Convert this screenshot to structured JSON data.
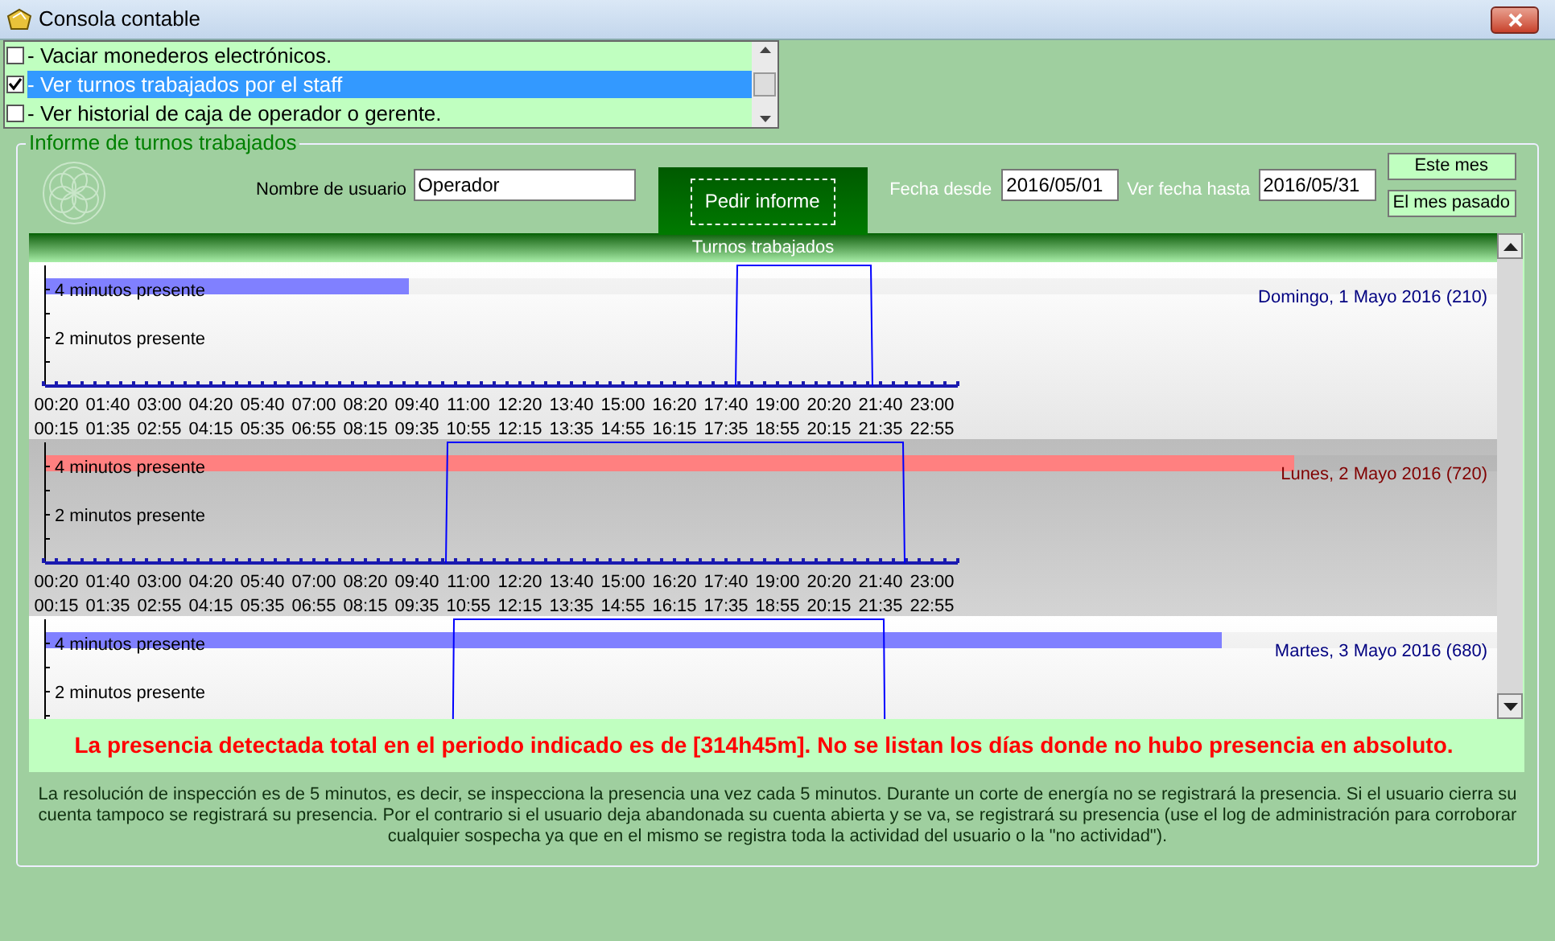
{
  "window": {
    "title": "Consola contable"
  },
  "tasks": [
    {
      "label": "- Vaciar monederos electrónicos.",
      "checked": false,
      "selected": false
    },
    {
      "label": "- Ver turnos trabajados por el staff",
      "checked": true,
      "selected": true
    },
    {
      "label": "- Ver historial de caja de operador o gerente.",
      "checked": false,
      "selected": false
    }
  ],
  "report": {
    "title": "Informe de turnos trabajados",
    "user_label": "Nombre de usuario",
    "user_value": "Operador",
    "request_button": "Pedir informe",
    "from_label": "Fecha desde",
    "from_value": "2016/05/01",
    "to_label": "Ver fecha hasta",
    "to_value": "2016/05/31",
    "buttons": [
      "Este mes",
      "El mes pasado"
    ],
    "chart_header": "Turnos trabajados",
    "days": [
      {
        "label": "Domingo, 1 Mayo 2016 (210)",
        "alert": false,
        "level": 0.25,
        "y_labels": [
          "4 minutos presente",
          "2 minutos presente"
        ],
        "x_labels": [
          "00:20",
          "01:40",
          "03:00",
          "04:20",
          "05:40",
          "07:00",
          "08:20",
          "09:40",
          "11:00",
          "12:20",
          "13:40",
          "15:00",
          "16:20",
          "17:40",
          "19:00",
          "20:20",
          "21:40",
          "23:00"
        ],
        "x_sublabels": [
          "00:15",
          "01:35",
          "02:55",
          "04:15",
          "05:35",
          "06:55",
          "08:15",
          "09:35",
          "10:55",
          "12:15",
          "13:35",
          "14:55",
          "16:15",
          "17:35",
          "18:55",
          "20:15",
          "21:35",
          "22:55"
        ]
      },
      {
        "label": "Lunes, 2 Mayo 2016 (720)",
        "alert": true,
        "level": 0.86,
        "y_labels": [
          "4 minutos presente",
          "2 minutos presente"
        ],
        "x_labels": [
          "00:20",
          "01:40",
          "03:00",
          "04:20",
          "05:40",
          "07:00",
          "08:20",
          "09:40",
          "11:00",
          "12:20",
          "13:40",
          "15:00",
          "16:20",
          "17:40",
          "19:00",
          "20:20",
          "21:40",
          "23:00"
        ],
        "x_sublabels": [
          "00:15",
          "01:35",
          "02:55",
          "04:15",
          "05:35",
          "06:55",
          "08:15",
          "09:35",
          "10:55",
          "12:15",
          "13:35",
          "14:55",
          "16:15",
          "17:35",
          "18:55",
          "20:15",
          "21:35",
          "22:55"
        ]
      },
      {
        "label": "Martes, 3 Mayo 2016 (680)",
        "alert": false,
        "level": 0.81,
        "y_labels": [
          "4 minutos presente",
          "2 minutos presente"
        ]
      }
    ],
    "summary": "La presencia detectada total en el periodo indicado es de [314h45m]. No se listan los días donde no hubo presencia en absoluto.",
    "note": "La resolución de inspección es de 5 minutos, es decir, se inspecciona la presencia una vez cada 5 minutos. Durante un corte de energía no se registrará la presencia. Si el usuario cierra su cuenta tampoco se registrará su presencia. Por el contrario si el usuario deja abandonada su cuenta abierta y se va, se registrará su presencia (use el log de administración para corroborar cualquier sospecha ya que en el mismo se registra toda la actividad del usuario o la \"no actividad\")."
  }
}
